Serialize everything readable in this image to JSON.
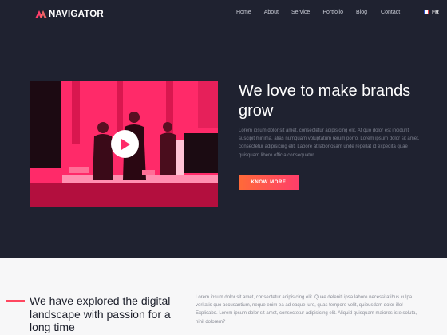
{
  "brand": {
    "name": "NAVIGATOR",
    "logo_icon": "double-triangle-logo",
    "accent": "#ff3e6a"
  },
  "nav": {
    "items": [
      "Home",
      "About",
      "Service",
      "Portfolio",
      "Blog",
      "Contact"
    ],
    "language": "FR",
    "language_icon": "france-flag-icon"
  },
  "hero": {
    "title": "We love to make brands grow",
    "body": "Lorem ipsum dolor sit amet, consectetur adipisicing elit. At quo dolor est incidunt suscipit minima, alias numquam voluptatum rerum porro. Lorem ipsum dolor sit amet, consectetur adipisicing elit. Labore at laboriosam unde repellat id expedita quae quisquam libero officia consequatur.",
    "button_label": "KNOW MORE",
    "media_icon": "play-icon"
  },
  "about": {
    "title": "We have explored the digital landscape with passion for a long time",
    "body": "Lorem ipsum dolor sit amet, consectetur adipisicing elit. Quae deleniti ipsa labore necessitatibus culpa veritatis quo accusantium, neque enim ea ad eaque iure, quas tempore velit, quibusdam dolor illo! Explicabo. Lorem ipsum dolor sit amet, consectetur adipisicing elit. Aliquid quisquam maiores iste soluta, nihil dolorem?"
  },
  "colors": {
    "hero_bg": "#1f2230",
    "light_bg": "#f7f7f8",
    "button_from": "#ff6a38",
    "button_to": "#ff3e6a"
  }
}
